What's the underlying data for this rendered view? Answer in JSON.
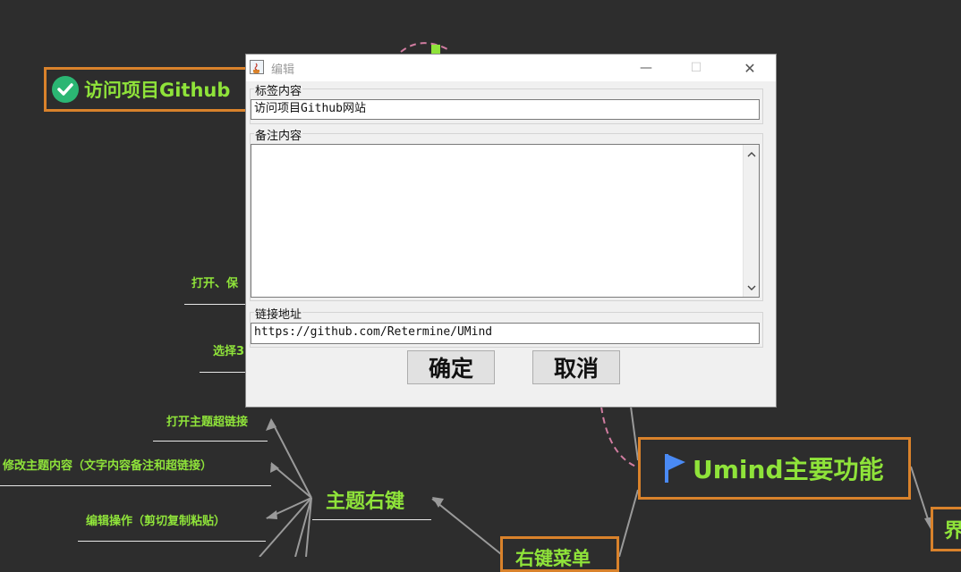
{
  "mindmap": {
    "top_node_label": "访问项目Github",
    "main_node_label": "Umind主要功能",
    "right_node_label": "界",
    "bottom_node_label": "右键菜单",
    "topic_context_label": "主题右键",
    "leaves": [
      "打开、保",
      "选择3",
      "打开主题超链接",
      "修改主题内容（文字内容备注和超链接）",
      "编辑操作（剪切复制粘贴）"
    ],
    "icons": [
      "check-circle-icon",
      "blue-flag-icon"
    ],
    "colors": {
      "background": "#2d2d2d",
      "node_border": "#d9822b",
      "node_text": "#8fe33a",
      "link_line": "#9a9a9a",
      "dashed_link": "#d07ca0"
    }
  },
  "dialog": {
    "title": "编辑",
    "window_controls": {
      "minimize": "—",
      "maximize": "☐",
      "close": "✕"
    },
    "label_section": {
      "title": "标签内容",
      "value": "访问项目Github网站"
    },
    "note_section": {
      "title": "备注内容",
      "value": ""
    },
    "link_section": {
      "title": "链接地址",
      "value": "https://github.com/Retermine/UMind"
    },
    "buttons": {
      "ok": "确定",
      "cancel": "取消"
    }
  }
}
